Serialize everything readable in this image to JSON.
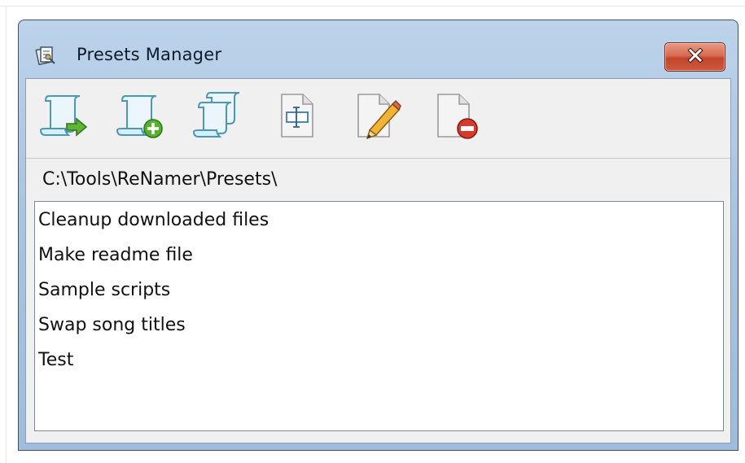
{
  "window": {
    "title": "Presets Manager",
    "title_icon": "presets-icon",
    "close_icon": "close-icon"
  },
  "toolbar": {
    "buttons": [
      {
        "name": "load-preset-button",
        "icon": "scroll-arrow-icon"
      },
      {
        "name": "create-preset-button",
        "icon": "scroll-plus-icon"
      },
      {
        "name": "import-preset-button",
        "icon": "scrolls-icon"
      },
      {
        "name": "rename-preset-button",
        "icon": "rename-icon"
      },
      {
        "name": "edit-preset-button",
        "icon": "pencil-icon"
      },
      {
        "name": "delete-preset-button",
        "icon": "delete-icon"
      }
    ]
  },
  "path": "C:\\Tools\\ReNamer\\Presets\\",
  "presets": [
    "Cleanup downloaded files",
    "Make readme file",
    "Sample scripts",
    "Swap song titles",
    "Test"
  ],
  "colors": {
    "titlebar": "#a9c4e0",
    "close_button": "#c2452b",
    "client": "#f0f0f0",
    "list_bg": "#ffffff"
  }
}
